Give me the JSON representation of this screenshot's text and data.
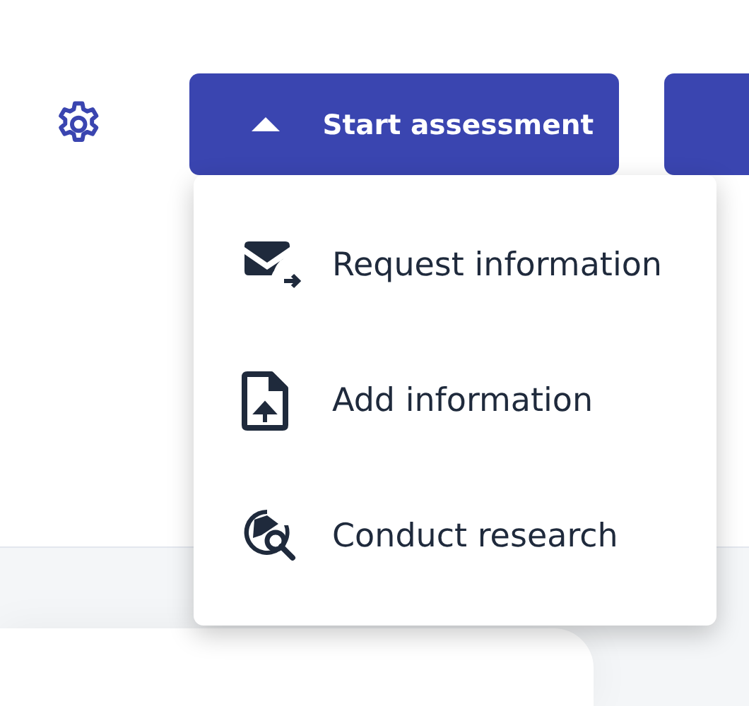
{
  "toolbar": {
    "start_button": {
      "label": "Start assessment",
      "expanded": true
    }
  },
  "menu": {
    "items": [
      {
        "kind": "mail-send",
        "label": "Request information"
      },
      {
        "kind": "file-upload",
        "label": "Add information"
      },
      {
        "kind": "globe-search",
        "label": "Conduct research"
      }
    ]
  }
}
